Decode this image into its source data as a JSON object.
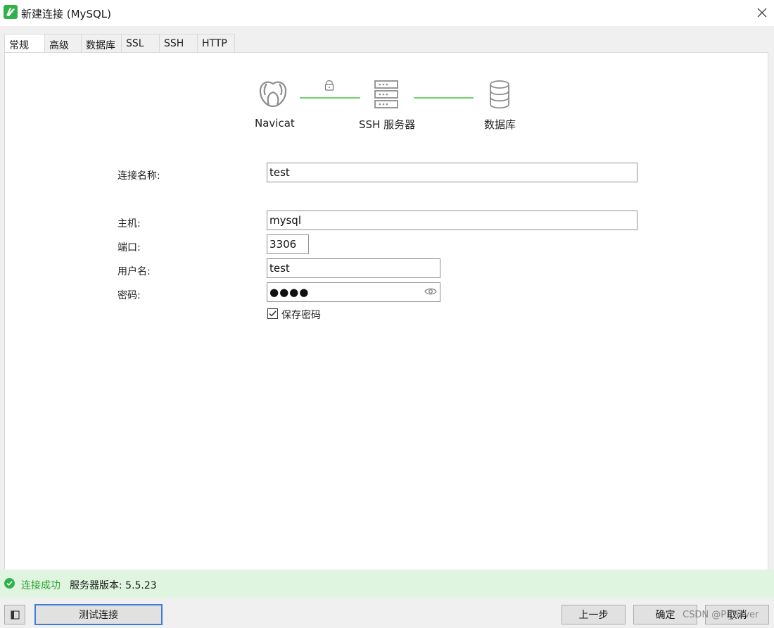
{
  "window": {
    "title": "新建连接 (MySQL)",
    "app_icon": "navicat-icon",
    "close_icon": "close-icon"
  },
  "tabs": [
    {
      "label": "常规",
      "active": true
    },
    {
      "label": "高级"
    },
    {
      "label": "数据库"
    },
    {
      "label": "SSL"
    },
    {
      "label": "SSH"
    },
    {
      "label": "HTTP"
    }
  ],
  "diagram": {
    "client_label": "Navicat",
    "server_label": "SSH 服务器",
    "database_label": "数据库",
    "lock_icon": "lock-icon",
    "line_color": "#6fd36f"
  },
  "form": {
    "connection_name_label": "连接名称:",
    "connection_name_value": "test",
    "host_label": "主机:",
    "host_value": "mysql",
    "port_label": "端口:",
    "port_value": "3306",
    "username_label": "用户名:",
    "username_value": "test",
    "password_label": "密码:",
    "password_value": "●●●●",
    "save_password_label": "保存密码",
    "save_password_checked": true
  },
  "status": {
    "success_text": "连接成功",
    "server_version_text": "服务器版本: 5.5.23",
    "success_color": "#2fa33a"
  },
  "buttons": {
    "test_connection": "测试连接",
    "previous": "上一步",
    "ok": "确定",
    "cancel": "取消"
  },
  "watermark": "CSDN @Pi_Silver"
}
